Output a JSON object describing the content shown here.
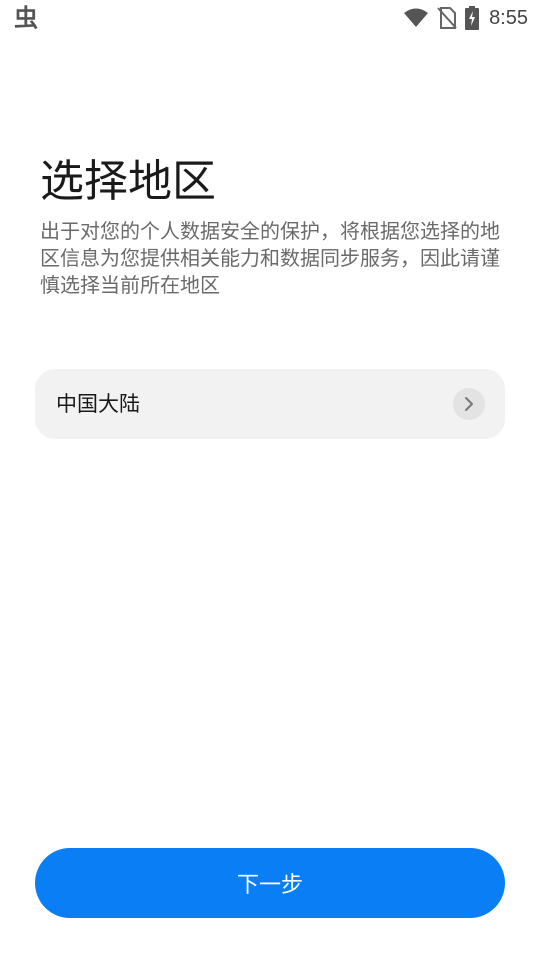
{
  "status_bar": {
    "left_glyph": "虫",
    "time": "8:55",
    "icons": [
      "wifi-icon",
      "no-sim-icon",
      "battery-charging-icon"
    ]
  },
  "page": {
    "title": "选择地区",
    "description": "出于对您的个人数据安全的保护，将根据您选择的地区信息为您提供相关能力和数据同步服务，因此请谨慎选择当前所在地区"
  },
  "region_selector": {
    "value": "中国大陆",
    "icon": "chevron-right-icon"
  },
  "footer": {
    "next_label": "下一步"
  },
  "colors": {
    "accent": "#0a7ff5",
    "row_background": "#f2f2f2",
    "secondary_text": "#6a6a6a"
  }
}
